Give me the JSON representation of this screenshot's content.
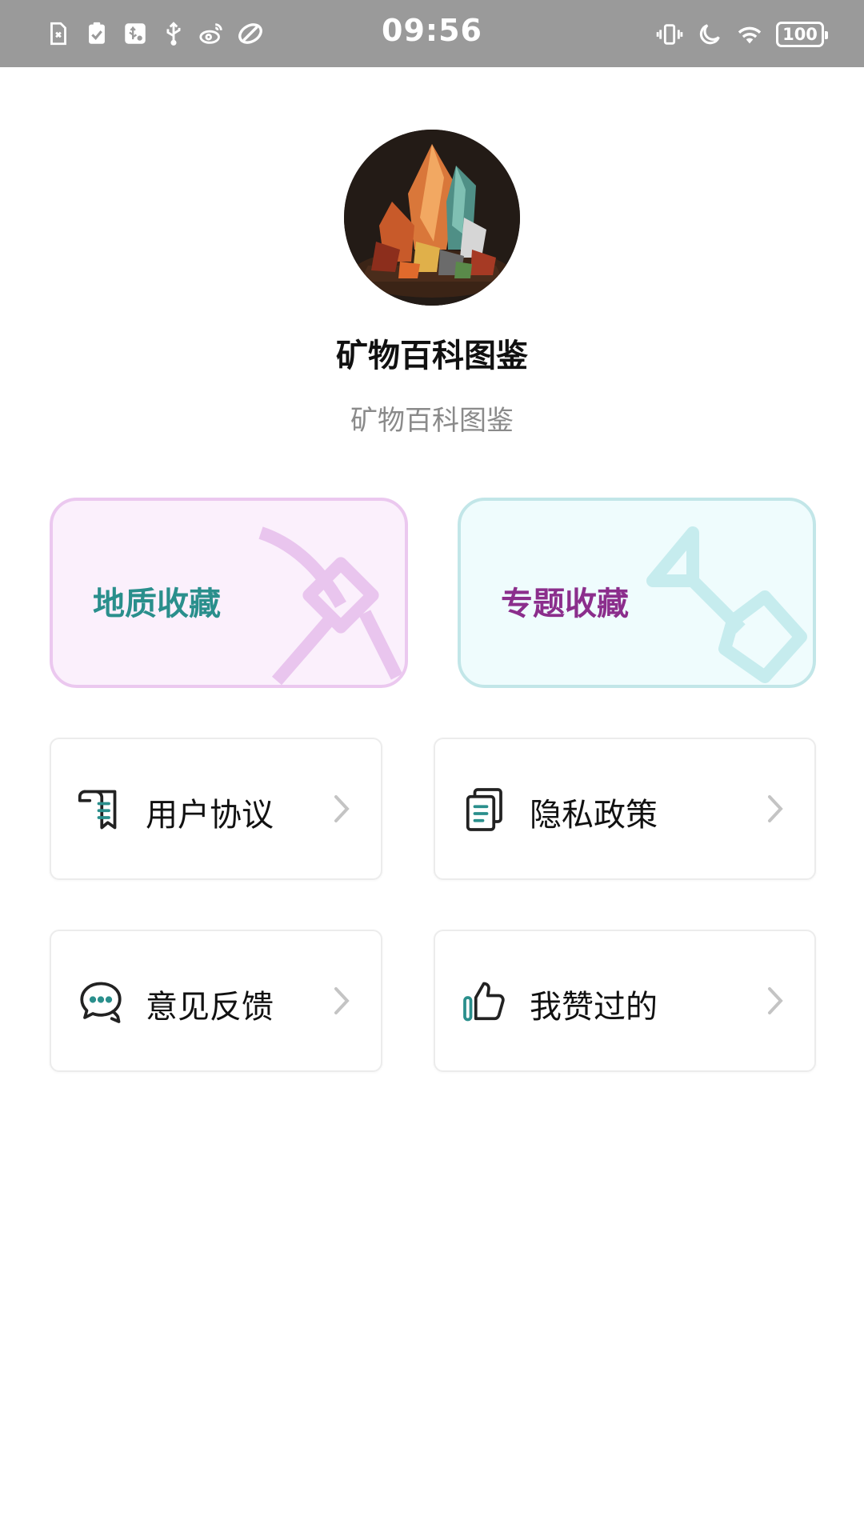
{
  "status_bar": {
    "time": "09:56",
    "battery": "100",
    "left_icons": [
      "sim-card-icon",
      "clipboard-check-icon",
      "usb-settings-icon",
      "usb-icon",
      "weibo-icon",
      "app-icon"
    ],
    "right_icons": [
      "vibrate-icon",
      "moon-icon",
      "wifi-icon",
      "battery-icon"
    ]
  },
  "profile": {
    "avatar": "minerals-avatar",
    "title": "矿物百科图鉴",
    "subtitle": "矿物百科图鉴"
  },
  "collections": [
    {
      "label": "地质收藏",
      "icon": "pickaxe-icon",
      "color": "#2a8f8c"
    },
    {
      "label": "专题收藏",
      "icon": "shovel-icon",
      "color": "#8b2e8c"
    }
  ],
  "menu": [
    {
      "label": "用户协议",
      "icon": "scroll-document-icon"
    },
    {
      "label": "隐私政策",
      "icon": "documents-icon"
    },
    {
      "label": "意见反馈",
      "icon": "chat-bubbles-icon"
    },
    {
      "label": "我赞过的",
      "icon": "thumbs-up-icon"
    }
  ],
  "colors": {
    "status_bar_bg": "#9a9a9a",
    "teal_accent": "#2a8f8c",
    "purple_accent": "#8b2e8c"
  }
}
